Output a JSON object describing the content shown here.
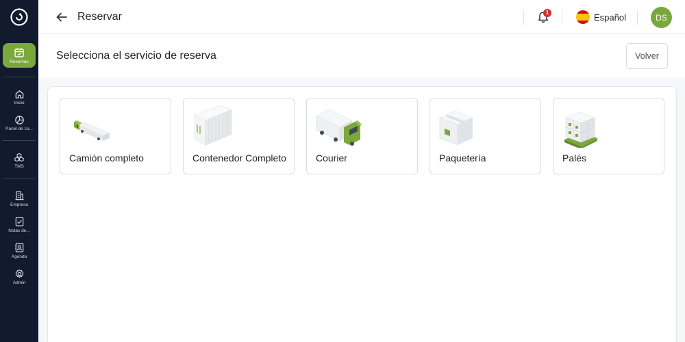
{
  "sidebar": {
    "active": {
      "label": "Reservas",
      "icon": "calendar-icon"
    },
    "items": [
      {
        "label": "Inicio",
        "icon": "home-icon"
      },
      {
        "label": "Panel de co...",
        "icon": "pie-chart-icon"
      },
      {
        "label": "TMS",
        "icon": "cubes-icon"
      },
      {
        "label": "Empresa",
        "icon": "building-icon"
      },
      {
        "label": "Notas de...",
        "icon": "document-check-icon"
      },
      {
        "label": "Agenda",
        "icon": "contacts-icon"
      },
      {
        "label": "Admin",
        "icon": "gear-icon"
      }
    ]
  },
  "topbar": {
    "title": "Reservar",
    "notification_count": "1",
    "language": "Español",
    "avatar_initials": "DS"
  },
  "page": {
    "title": "Selecciona el servicio de reserva",
    "back_button": "Volver"
  },
  "services": [
    {
      "label": "Camión completo",
      "icon": "truck-icon"
    },
    {
      "label": "Contenedor Completo",
      "icon": "container-icon"
    },
    {
      "label": "Courier",
      "icon": "courier-van-icon"
    },
    {
      "label": "Paquetería",
      "icon": "package-icon"
    },
    {
      "label": "Palés",
      "icon": "pallet-icon"
    }
  ],
  "colors": {
    "sidebar_bg": "#121a2e",
    "accent_green": "#7aa83b",
    "badge_red": "#d32f2f"
  }
}
